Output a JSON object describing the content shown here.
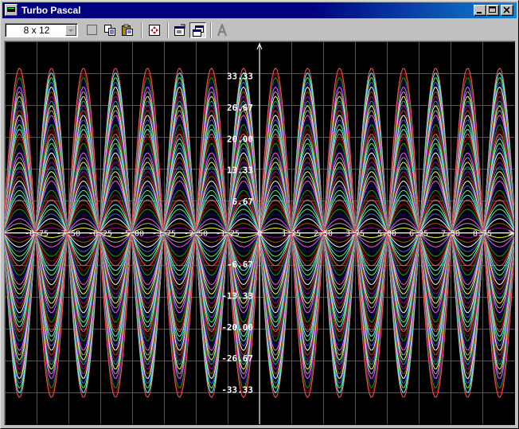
{
  "window": {
    "title": "Turbo Pascal"
  },
  "titlebar_buttons": [
    "minimize-icon",
    "maximize-icon",
    "close-icon"
  ],
  "toolbar": {
    "font_size": "8 x 12",
    "tools": [
      {
        "name": "mark-tool",
        "icon": "dotted-rectangle-icon",
        "pressed": false
      },
      {
        "name": "copy-tool",
        "icon": "copy-icon",
        "pressed": false
      },
      {
        "name": "paste-tool",
        "icon": "paste-icon",
        "pressed": false
      },
      {
        "name": "fullscreen-tool",
        "icon": "fullscreen-arrows-icon",
        "pressed": false
      },
      {
        "name": "properties-tool",
        "icon": "properties-icon",
        "pressed": false
      },
      {
        "name": "background-tool",
        "icon": "window-stack-icon",
        "pressed": true
      },
      {
        "name": "font-tool",
        "icon": "font-a-icon",
        "pressed": false
      }
    ]
  },
  "chart_data": {
    "type": "line",
    "function": "y = a*sin(x)",
    "x_range": [
      -10,
      10
    ],
    "y_range": [
      -40,
      40
    ],
    "amplitudes": [
      -35,
      -34,
      -33,
      -32,
      -31,
      -30,
      -29,
      -28,
      -27,
      -26,
      -25,
      -24,
      -23,
      -22,
      -21,
      -20,
      -19,
      -18,
      -17,
      -16,
      -15,
      -14,
      -13,
      -12,
      -11,
      -10,
      -9,
      -8,
      -7,
      -6,
      -5,
      -4,
      -3,
      -2,
      -1,
      0,
      1,
      2,
      3,
      4,
      5,
      6,
      7,
      8,
      9,
      10,
      11,
      12,
      13,
      14,
      15,
      16,
      17,
      18,
      19,
      20,
      21,
      22,
      23,
      24,
      25,
      26,
      27,
      28,
      29,
      30,
      31,
      32,
      33,
      34,
      35
    ],
    "palette": [
      "#ff5555",
      "#55ffff",
      "#55ff55",
      "#5555ff",
      "#ffffff",
      "#aa5500",
      "#aa00aa",
      "#00aaaa",
      "#ffff55",
      "#aaaaaa",
      "#ff55ff",
      "#0000aa",
      "#00aa00",
      "#aa0000"
    ],
    "grid": true,
    "y_ticks": [
      "33.33",
      "26.67",
      "20.00",
      "13.33",
      "6.67",
      "-6.67",
      "-13.33",
      "-20.00",
      "-26.67",
      "-33.33"
    ],
    "y_tick_values": [
      33.33,
      26.67,
      20,
      13.33,
      6.67,
      -6.67,
      -13.33,
      -20,
      -26.67,
      -33.33
    ],
    "x_ticks": [
      "-8.75",
      "-7.50",
      "-6.25",
      "-5.00",
      "-3.75",
      "-2.50",
      "-1.25",
      "0",
      "1.25",
      "2.50",
      "3.75",
      "5.00",
      "6.25",
      "7.50",
      "8.75"
    ],
    "x_tick_values": [
      -8.75,
      -7.5,
      -6.25,
      -5,
      -3.75,
      -2.5,
      -1.25,
      0,
      1.25,
      2.5,
      3.75,
      5,
      6.25,
      7.5,
      8.75
    ]
  }
}
